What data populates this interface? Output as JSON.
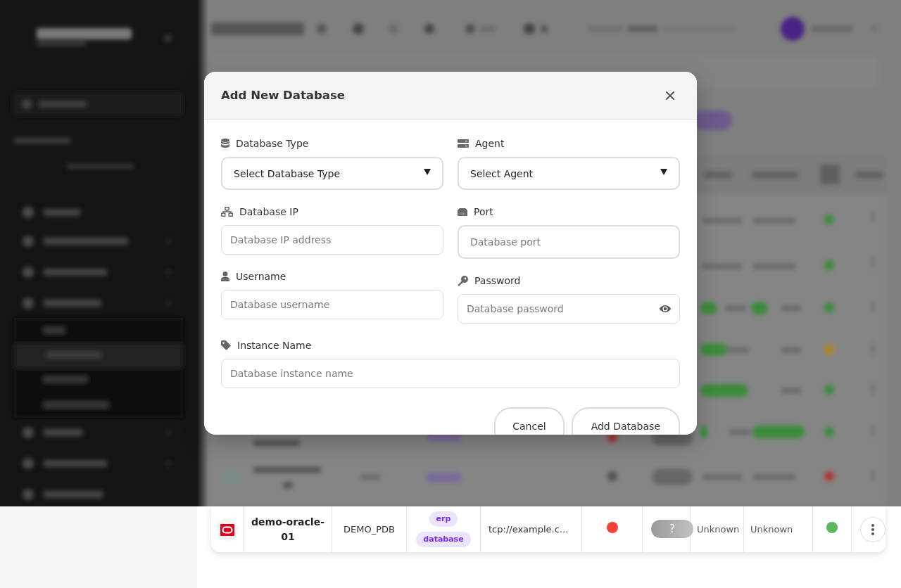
{
  "dialog": {
    "title": "Add New Database",
    "columns": [
      [
        {
          "kind": "select",
          "label": "Database Type",
          "value": "Select Database Type"
        },
        {
          "kind": "text",
          "label": "Database IP",
          "placeholder": "Database IP address"
        },
        {
          "kind": "text",
          "label": "Username",
          "placeholder": "Database username"
        }
      ],
      [
        {
          "kind": "select",
          "label": "Agent",
          "value": "Select Agent"
        },
        {
          "kind": "number",
          "label": "Port",
          "placeholder": "Database port"
        },
        {
          "kind": "password",
          "label": "Password",
          "placeholder": "Database password"
        }
      ]
    ],
    "wide_fields": [
      {
        "kind": "text",
        "label": "Instance Name",
        "placeholder": "Database instance name"
      }
    ],
    "buttons": [
      "Cancel",
      "Add Database"
    ]
  },
  "table_row": {
    "cells": [
      {
        "kind": "logo"
      },
      {
        "kind": "name",
        "text": "demo-oracle-01"
      },
      {
        "kind": "text",
        "text": "DEMO_PDB"
      },
      {
        "kind": "tags",
        "tags": [
          "erp",
          "database"
        ]
      },
      {
        "kind": "text",
        "text": "tcp://example.c..."
      },
      {
        "kind": "dot",
        "color": "#f44336"
      },
      {
        "kind": "pill",
        "text": "?"
      },
      {
        "kind": "muted",
        "text": "Unknown"
      },
      {
        "kind": "muted",
        "text": "Unknown"
      },
      {
        "kind": "dot",
        "color": "#5cb85c"
      },
      {
        "kind": "menu"
      }
    ]
  }
}
